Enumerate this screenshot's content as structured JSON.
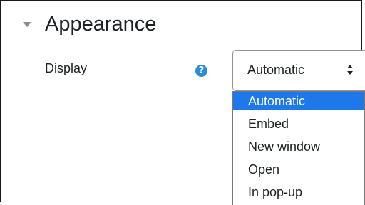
{
  "section": {
    "title": "Appearance"
  },
  "display_field": {
    "label": "Display",
    "help_icon": "?",
    "selected_value": "Automatic",
    "options": [
      "Automatic",
      "Embed",
      "New window",
      "Open",
      "In pop-up"
    ],
    "highlight_color": "#1e78ea"
  }
}
